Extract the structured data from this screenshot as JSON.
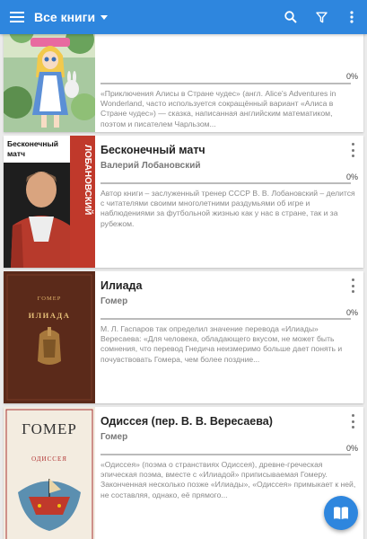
{
  "appbar": {
    "title": "Все книги",
    "icons": [
      "menu-icon",
      "search-icon",
      "filter-icon",
      "more-vert-icon"
    ],
    "color": "#2e86de"
  },
  "books": [
    {
      "title": "",
      "author": "",
      "progress": "0%",
      "description": "«Приключения Алисы в Стране чудес» (англ. Alice's Adventures in Wonderland, часто используется сокращённый вариант «Алиса в Стране чудес») — сказка, написанная английским математиком, поэтом и писателем Чарльзом..."
    },
    {
      "title": "Бесконечный матч",
      "author": "Валерий Лобановский",
      "progress": "0%",
      "cover_text": "Бесконечный матч",
      "cover_author": "ВАЛЕРИЙ ЛОБАНОВСКИЙ",
      "description": "Автор книги – заслуженный тренер СССР В. В. Лобановский – делится с читателями своими многолетними раздумьями об игре и наблюдениями за футбольной жизнью как у нас в стране, так и за рубежом."
    },
    {
      "title": "Илиада",
      "author": "Гомер",
      "progress": "0%",
      "cover_author": "ГОМЕР",
      "cover_text": "ИЛИАДА",
      "description": "М. Л. Гаспаров так определил значение перевода «Илиады» Вересаева: «Для человека, обладающего вкусом, не может быть сомнения, что перевод Гнедича неизмеримо больше дает понять и почувствовать Гомера, чем более поздние..."
    },
    {
      "title": "Одиссея (пер. В. В. Вересаева)",
      "author": "Гомер",
      "progress": "0%",
      "cover_author": "ГОМЕР",
      "cover_text": "ОДИССЕЯ",
      "description": "«Одиссея» (поэма о странствиях Одиссея), древне-греческая эпическая поэма, вместе с «Илиадой» приписываемая Гомеру. Законченная несколько позже «Илиады», «Одиссея» примыкает к ней, не составляя, однако, её прямого..."
    }
  ],
  "fab": {
    "icon": "book-icon"
  }
}
